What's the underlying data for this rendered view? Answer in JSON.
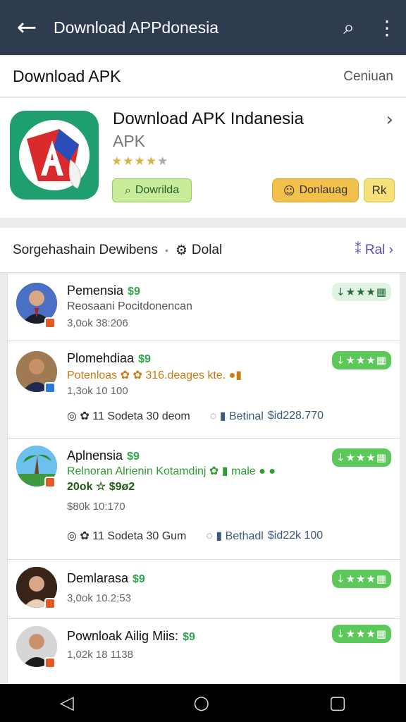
{
  "topbar": {
    "back_icon": "←",
    "title": "Download APPdonesia",
    "search_icon": "⌕",
    "menu_icon": "⋮"
  },
  "section": {
    "title": "Download APK",
    "link": "Ceniuan"
  },
  "app": {
    "name": "Download APK Indanesia",
    "subtitle": "APK",
    "stars": "★★★★",
    "star_off": "★",
    "chevron": "›",
    "download_label": "Dowrilda",
    "download2_label": "Donlauag",
    "rk_label": "Rk",
    "icon_colors": {
      "bg": "#1f9e6e",
      "red": "#d92b2b",
      "blue": "#2b4db8",
      "white": "#ffffff"
    }
  },
  "filter": {
    "label": "Sorgehashain Dewibens",
    "sep": "•",
    "detail": "Dolal",
    "right": "⁑ Ral ›"
  },
  "items": [
    {
      "name": "Pemensia",
      "tag": "$9",
      "line2": "Reosaani Pocitdonencan",
      "meta": "3,0ok 38:206",
      "pill": "↓★★★▦"
    },
    {
      "name": "Plomehdiaa",
      "tag": "$9",
      "line2": "Potenloas ✿ ✿ 316.deages kte. ●▮",
      "meta": "1,3ok 10 100",
      "stats": {
        "a": "◎ ✿ 11 Sodeta 30 deom",
        "b": "◌ ▮ Betinal",
        "c": "$id228.770"
      },
      "pill": "↓★★★▦"
    },
    {
      "name": "Aplnensia",
      "tag": "$9",
      "line2": "Relnoran Alrienin Kotamdinj ✿ ▮ male ● ●",
      "line3": "20ok ☆ $9ø2",
      "meta": "$80k 10:170",
      "stats": {
        "a": "◎ ✿ 11 Sodeta 30 Gum",
        "b": "◌ ▮ Bethadl",
        "c": "$id22k 100"
      },
      "pill": "↓★★★▦"
    },
    {
      "name": "Demlarasa",
      "tag": "$9",
      "meta": "3,0ok 10.2:53",
      "pill": "↓★★★▦"
    },
    {
      "name": "Pownloak Ailig Miis:",
      "tag": "$9",
      "meta": "1,02k 18 1138",
      "pill": "↓★★★▦"
    }
  ],
  "navbar": {
    "back": "◁",
    "home": "○",
    "recents": "▢"
  }
}
